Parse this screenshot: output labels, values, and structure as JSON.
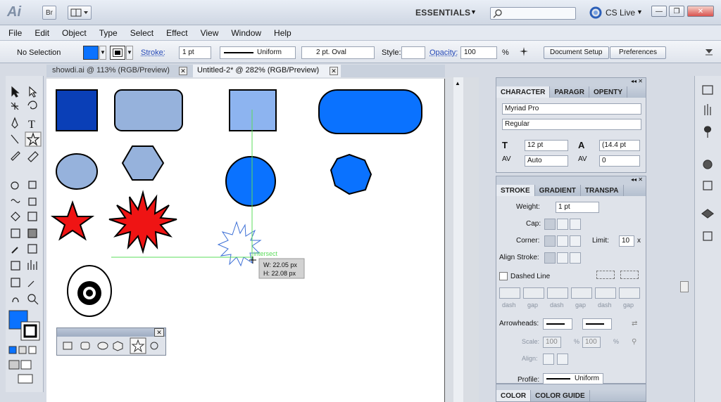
{
  "app": {
    "logo": "Ai",
    "bridge_button": "Br",
    "workspace": "ESSENTIALS",
    "cslive": "CS Live",
    "colors": {
      "accent": "#0a72ff",
      "dark_blue": "#0a3fb7",
      "light_blue": "#96b2dc",
      "sky": "#8db4f0",
      "red": "#ef1414"
    }
  },
  "menu": [
    "File",
    "Edit",
    "Object",
    "Type",
    "Select",
    "Effect",
    "View",
    "Window",
    "Help"
  ],
  "control": {
    "selection": "No Selection",
    "stroke_label": "Stroke:",
    "stroke_weight": "1 pt",
    "stroke_style": "Uniform",
    "brush": "2 pt. Oval",
    "style_label": "Style:",
    "opacity_label": "Opacity:",
    "opacity_value": "100",
    "opacity_unit": "%",
    "doc_setup": "Document Setup",
    "preferences": "Preferences"
  },
  "tabs": [
    {
      "label": "showdi.ai @ 113% (RGB/Preview)"
    },
    {
      "label": "Untitled-2* @ 282% (RGB/Preview)"
    }
  ],
  "canvas": {
    "smart_guide": "intersect",
    "measure_w": "W: 22.05 px",
    "measure_h": "H: 22.08 px"
  },
  "character": {
    "tabs": [
      "CHARACTER",
      "PARAGR",
      "OPENTY"
    ],
    "font": "Myriad Pro",
    "style": "Regular",
    "size": "12 pt",
    "leading": "(14.4 pt",
    "kerning": "Auto",
    "tracking": "0"
  },
  "stroke": {
    "tabs": [
      "STROKE",
      "GRADIENT",
      "TRANSPA"
    ],
    "weight_label": "Weight:",
    "weight_value": "1 pt",
    "cap_label": "Cap:",
    "corner_label": "Corner:",
    "limit_label": "Limit:",
    "limit_value": "10",
    "limit_unit": "x",
    "align_label": "Align Stroke:",
    "dashed_label": "Dashed Line",
    "dash_labels": [
      "dash",
      "gap",
      "dash",
      "gap",
      "dash",
      "gap"
    ],
    "arrowheads_label": "Arrowheads:",
    "scale_label": "Scale:",
    "scale_1": "100",
    "scale_2": "100",
    "scale_unit": "%",
    "align_arrow_label": "Align:",
    "profile_label": "Profile:",
    "profile_value": "Uniform"
  },
  "color_panel": {
    "tabs": [
      "COLOR",
      "COLOR GUIDE"
    ]
  }
}
